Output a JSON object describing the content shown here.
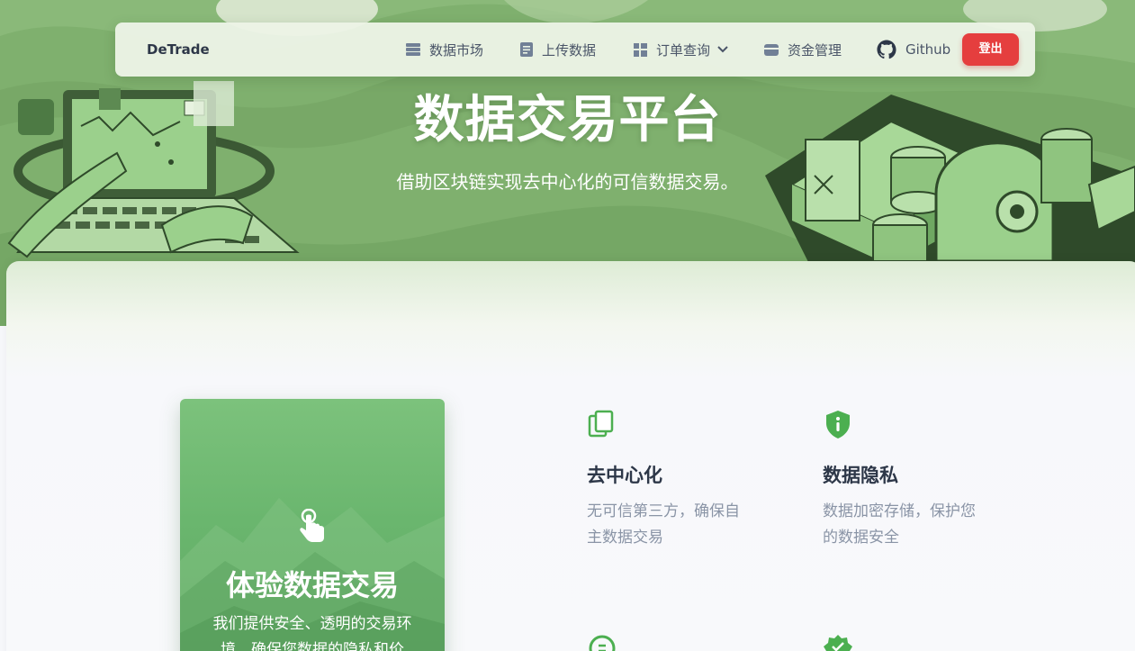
{
  "nav": {
    "brand": "DeTrade",
    "items": [
      {
        "label": "数据市场",
        "icon": "storage-icon"
      },
      {
        "label": "上传数据",
        "icon": "document-icon"
      },
      {
        "label": "订单查询",
        "icon": "grid-icon"
      },
      {
        "label": "资金管理",
        "icon": "wallet-icon"
      },
      {
        "label": "Github",
        "icon": "github-icon"
      }
    ],
    "logout": "登出"
  },
  "hero": {
    "title": "数据交易平台",
    "subtitle": "借助区块链实现去中心化的可信数据交易。"
  },
  "card": {
    "title": "体验数据交易",
    "description": "我们提供安全、透明的交易环境，确保您数据的隐私和价"
  },
  "features": [
    {
      "title": "去中心化",
      "description": "无可信第三方，确保自主数据交易",
      "icon": "copy-icon"
    },
    {
      "title": "数据隐私",
      "description": "数据加密存储，保护您的数据安全",
      "icon": "shield-info-icon"
    }
  ],
  "colors": {
    "accent": "#6ab66e",
    "hero": "#7fb06e",
    "danger": "#e53e3e",
    "icon_green": "#4caf50"
  }
}
